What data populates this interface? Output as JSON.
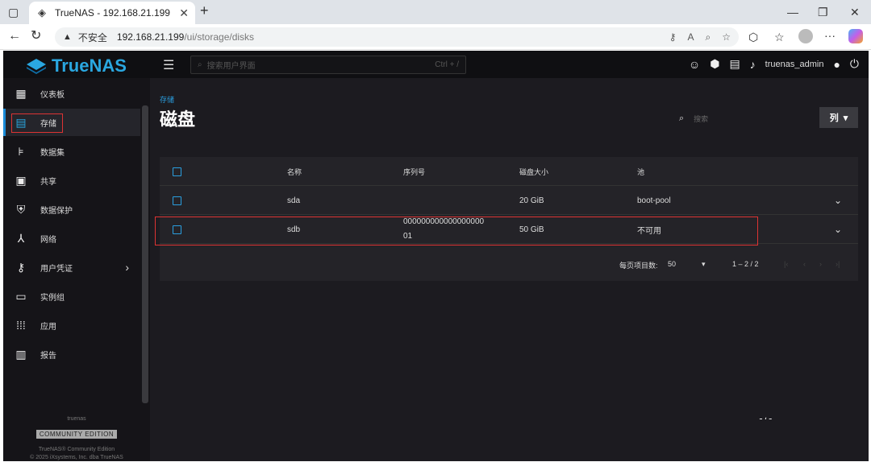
{
  "browser": {
    "tab_title": "TrueNAS - 192.168.21.199",
    "insecure_label": "不安全",
    "url_host": "192.168.21.199",
    "url_path": "/ui/storage/disks"
  },
  "app": {
    "logo_text": "TrueNAS",
    "search_placeholder": "搜索用户界面",
    "search_shortcut": "Ctrl + /",
    "username": "truenas_admin"
  },
  "sidebar": {
    "items": [
      {
        "label": "仪表板",
        "icon": "dashboard-icon"
      },
      {
        "label": "存储",
        "icon": "storage-icon"
      },
      {
        "label": "数据集",
        "icon": "datasets-icon"
      },
      {
        "label": "共享",
        "icon": "shares-icon"
      },
      {
        "label": "数据保护",
        "icon": "shield-icon"
      },
      {
        "label": "网络",
        "icon": "network-icon"
      },
      {
        "label": "用户凭证",
        "icon": "key-icon"
      },
      {
        "label": "实例组",
        "icon": "laptop-icon"
      },
      {
        "label": "应用",
        "icon": "apps-grid-icon"
      },
      {
        "label": "报告",
        "icon": "chart-icon"
      }
    ],
    "footer_hostname": "truenas",
    "footer_edition": "COMMUNITY EDITION",
    "footer_product": "TrueNAS® Community Edition",
    "footer_copyright": "© 2025 iXsystems, Inc. dba TrueNAS"
  },
  "page": {
    "breadcrumb": "存储",
    "title": "磁盘",
    "filter_placeholder": "搜索",
    "columns_button": "列"
  },
  "table": {
    "headers": [
      "名称",
      "序列号",
      "磁盘大小",
      "池"
    ],
    "rows": [
      {
        "name": "sda",
        "serial_line1": "",
        "serial_line2": "",
        "size": "20 GiB",
        "pool": "boot-pool"
      },
      {
        "name": "sdb",
        "serial_line1": "000000000000000000",
        "serial_line2": "01",
        "size": "50 GiB",
        "pool": "不可用"
      }
    ]
  },
  "pager": {
    "per_page_label": "每页项目数:",
    "per_page_value": "50",
    "range": "1 – 2 / 2"
  },
  "colors": {
    "accent": "#1a8cd8",
    "highlight": "#dd3333"
  }
}
